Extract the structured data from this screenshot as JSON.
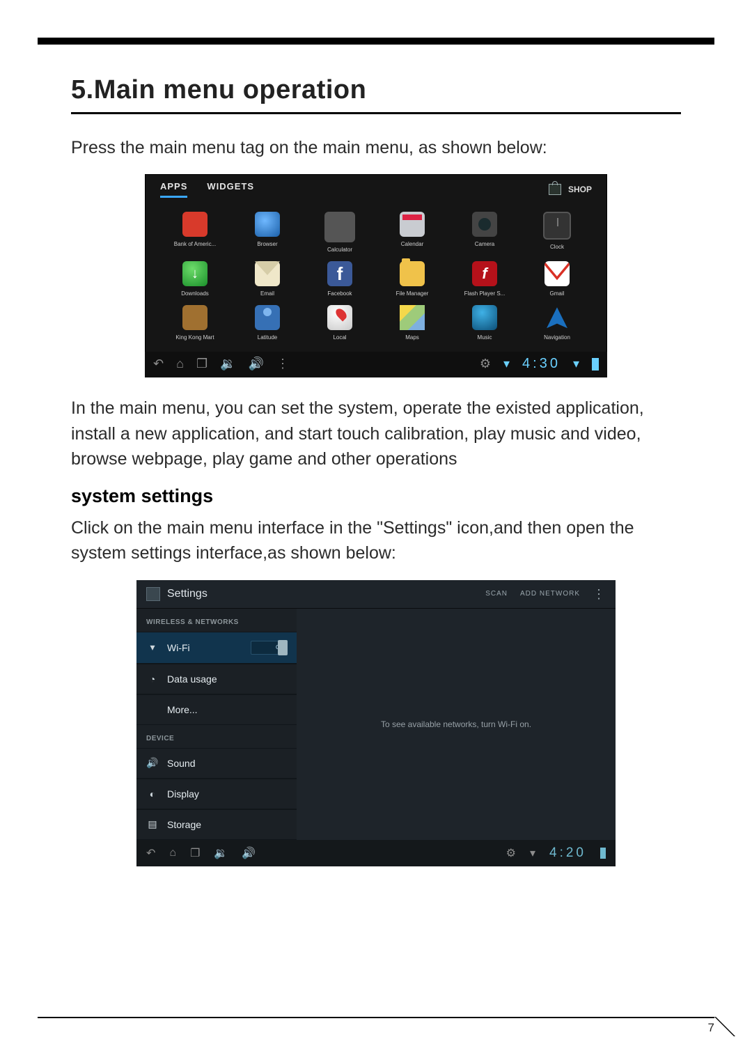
{
  "page_number": "7",
  "heading": "5.Main menu operation",
  "intro": "Press the main menu tag on the main menu, as shown below:",
  "para2": "In the main menu, you can set the system, operate the existed application, install a new application, and start touch calibration, play music and video, browse webpage, play game and other operations",
  "sub_heading": "system settings",
  "para3": "Click on the main menu interface in the \"Settings\" icon,and then open the system settings interface,as shown below:",
  "drawer": {
    "tabs": {
      "apps": "APPS",
      "widgets": "WIDGETS"
    },
    "shop": "SHOP",
    "apps": [
      "Bank of Americ...",
      "Browser",
      "Calculator",
      "Calendar",
      "Camera",
      "Clock",
      "Downloads",
      "Email",
      "Facebook",
      "File Manager",
      "Flash Player S...",
      "Gmail",
      "King Kong Mart",
      "Latitude",
      "Local",
      "Maps",
      "Music",
      "Navigation"
    ],
    "status": {
      "time": "4:30"
    }
  },
  "settings": {
    "title": "Settings",
    "scan": "SCAN",
    "add_network": "ADD NETWORK",
    "cat_wireless": "WIRELESS & NETWORKS",
    "cat_device": "DEVICE",
    "items": {
      "wifi": "Wi-Fi",
      "wifi_toggle": "ON",
      "data": "Data usage",
      "more": "More...",
      "sound": "Sound",
      "display": "Display",
      "storage": "Storage"
    },
    "main_msg": "To see available networks, turn Wi-Fi on.",
    "status": {
      "time": "4:20"
    }
  }
}
